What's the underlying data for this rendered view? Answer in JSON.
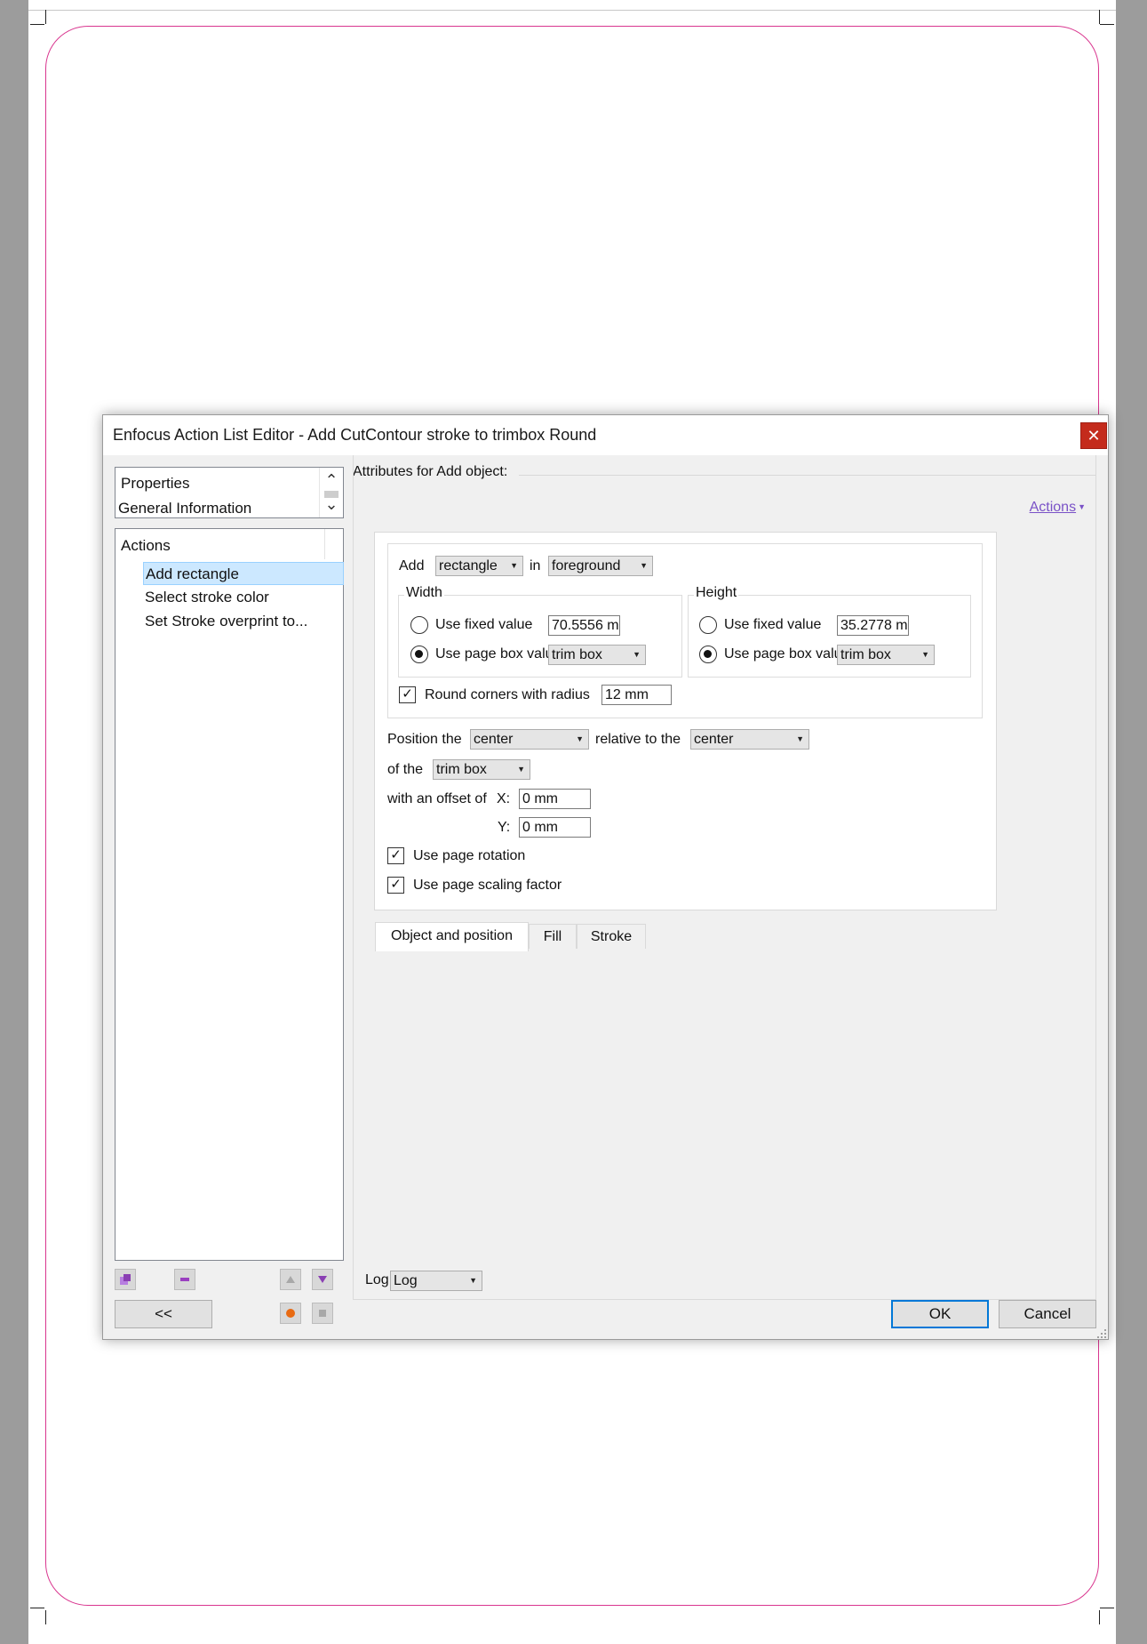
{
  "window": {
    "title": "Enfocus Action List Editor - Add CutContour stroke to trimbox Round",
    "close_label": "✕"
  },
  "properties_panel": {
    "items": [
      "Properties",
      "General Information"
    ]
  },
  "actions_panel": {
    "header": "Actions",
    "items": [
      "Add rectangle",
      "Select stroke color",
      "Set Stroke overprint to..."
    ],
    "selected_index": 0
  },
  "bottom_left": {
    "back_label": "<<"
  },
  "main": {
    "attributes_title": "Attributes for Add object:",
    "actions_menu": "Actions",
    "tabs": [
      "Object and position",
      "Fill",
      "Stroke"
    ],
    "active_tab": "Object and position",
    "add": {
      "label": "Add",
      "shape_value": "rectangle",
      "in_label": "in",
      "layer_value": "foreground"
    },
    "width": {
      "title": "Width",
      "fixed_label": "Use fixed value",
      "fixed_value": "70.5556 m",
      "pagebox_label": "Use page box value",
      "pagebox_value": "trim box",
      "selected": "pagebox"
    },
    "height": {
      "title": "Height",
      "fixed_label": "Use fixed value",
      "fixed_value": "35.2778 m",
      "pagebox_label": "Use page box value",
      "pagebox_value": "trim box",
      "selected": "pagebox"
    },
    "round_corners": {
      "label": "Round corners with radius",
      "value": "12 mm",
      "checked": true
    },
    "position": {
      "label": "Position the",
      "anchor_value": "center",
      "relative_label": "relative to the",
      "relative_value": "center",
      "of_the_label": "of the",
      "box_value": "trim box",
      "offset_label": "with an offset of",
      "x_label": "X:",
      "x_value": "0 mm",
      "y_label": "Y:",
      "y_value": "0 mm"
    },
    "use_page_rotation": {
      "label": "Use page rotation",
      "checked": true
    },
    "use_page_scaling": {
      "label": "Use page scaling factor",
      "checked": true
    },
    "log": {
      "label": "Log",
      "value": "Log"
    }
  },
  "footer": {
    "ok_label": "OK",
    "cancel_label": "Cancel"
  },
  "colors": {
    "cut_contour": "#d9368f",
    "close_button": "#c42b1c",
    "selection": "#cce8ff",
    "link": "#7a52c7",
    "default_button_border": "#0078d7"
  },
  "icons": {
    "check_glyph": "✓",
    "dropdown_glyph": "▼",
    "scroll_up_glyph": "⌃",
    "scroll_down_glyph": "⌄"
  }
}
